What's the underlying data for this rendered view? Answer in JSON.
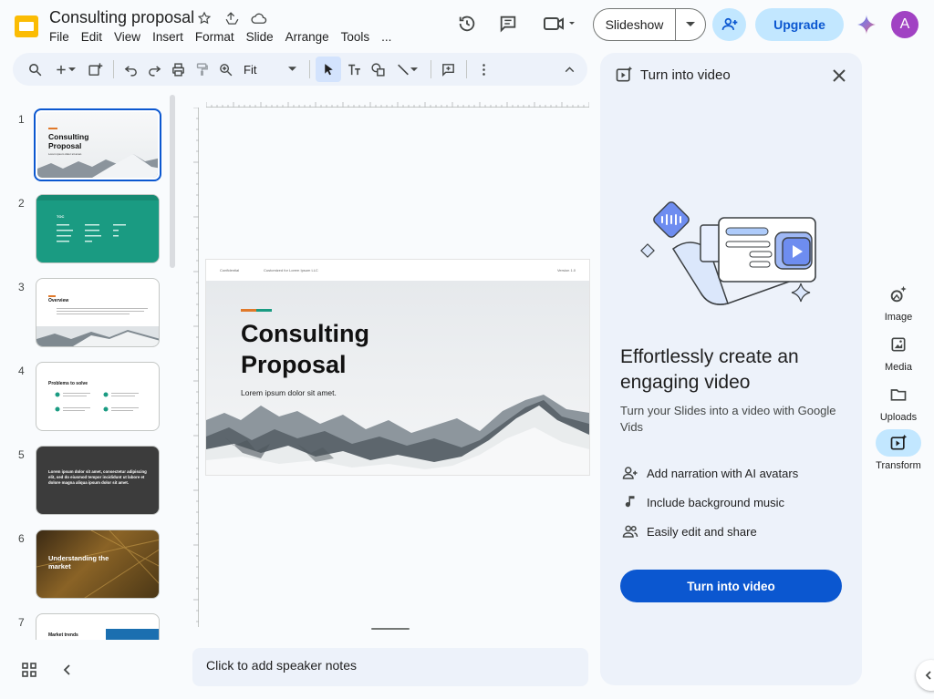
{
  "app": {
    "title": "Consulting proposal",
    "menu": [
      "File",
      "Edit",
      "View",
      "Insert",
      "Format",
      "Slide",
      "Arrange",
      "Tools",
      "..."
    ],
    "slideshow_label": "Slideshow",
    "upgrade_label": "Upgrade",
    "avatar_letter": "A",
    "brand_color": "#fbbc04",
    "accent_color": "#0b57d0"
  },
  "toolbar": {
    "zoom_value": "Fit"
  },
  "filmstrip": {
    "slides": [
      {
        "num": "1",
        "title": "Consulting Proposal",
        "sub": "Lorem ipsum dolor sit amet."
      },
      {
        "num": "2",
        "title": "TOC"
      },
      {
        "num": "3",
        "title": "Overview"
      },
      {
        "num": "4",
        "title": "Problems to solve"
      },
      {
        "num": "5",
        "title": "Lorem ipsum dolor sit amet, consectetur adipiscing elit, sed do eiusmod tempor incididunt ut labore et dolore magna aliqua ipsum dolor sit amet."
      },
      {
        "num": "6",
        "title": "Understanding the market"
      },
      {
        "num": "7",
        "title": "Market trends"
      }
    ]
  },
  "slide": {
    "header_left": "Confidential",
    "header_mid": "Customized for Lorem Ipsum LLC",
    "header_right": "Version 1.0",
    "title_line1": "Consulting",
    "title_line2": "Proposal",
    "subtitle": "Lorem ipsum dolor sit amet."
  },
  "notes": {
    "placeholder": "Click to add speaker notes"
  },
  "panel": {
    "header": "Turn into video",
    "heading": "Effortlessly create an engaging video",
    "description": "Turn your Slides into a video with Google Vids",
    "features": [
      {
        "icon": "person-add-icon",
        "label": "Add narration with AI avatars"
      },
      {
        "icon": "music-note-icon",
        "label": "Include background music"
      },
      {
        "icon": "people-icon",
        "label": "Easily edit and share"
      }
    ],
    "cta_label": "Turn into video"
  },
  "rail": [
    {
      "label": "Image",
      "icon": "image-spark-icon"
    },
    {
      "label": "Media",
      "icon": "media-icon"
    },
    {
      "label": "Uploads",
      "icon": "folder-icon"
    },
    {
      "label": "Transform",
      "icon": "transform-icon",
      "active": true
    }
  ]
}
